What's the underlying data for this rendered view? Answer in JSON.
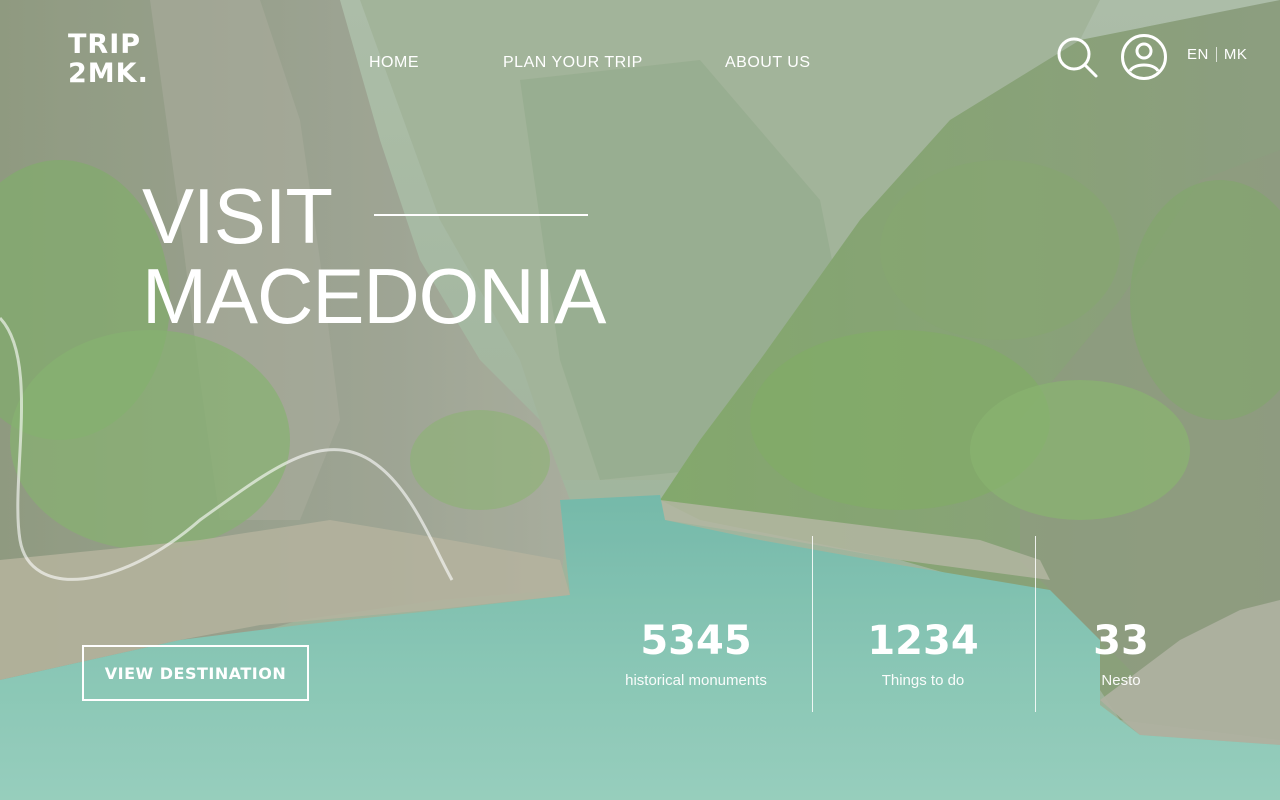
{
  "brand": {
    "line1": "TRIP",
    "line2": "2MK."
  },
  "nav": [
    {
      "label": "HOME"
    },
    {
      "label": "PLAN YOUR TRIP"
    },
    {
      "label": "ABOUT US"
    }
  ],
  "header_icons": {
    "search": "search-icon",
    "account": "user-icon"
  },
  "language": {
    "options": [
      "EN",
      "MK"
    ],
    "selected": "EN"
  },
  "hero": {
    "line1": "VISIT",
    "line2": "MACEDONIA"
  },
  "cta": {
    "label": "VIEW DESTINATION"
  },
  "stats": [
    {
      "value": "5345",
      "label": "historical monuments"
    },
    {
      "value": "1234",
      "label": "Things to do"
    },
    {
      "value": "33",
      "label": "Nesto"
    }
  ],
  "colors": {
    "text": "#ffffff",
    "water": "#6fb8a4",
    "foliage": "#6e9a56",
    "rock": "#8d927a"
  }
}
